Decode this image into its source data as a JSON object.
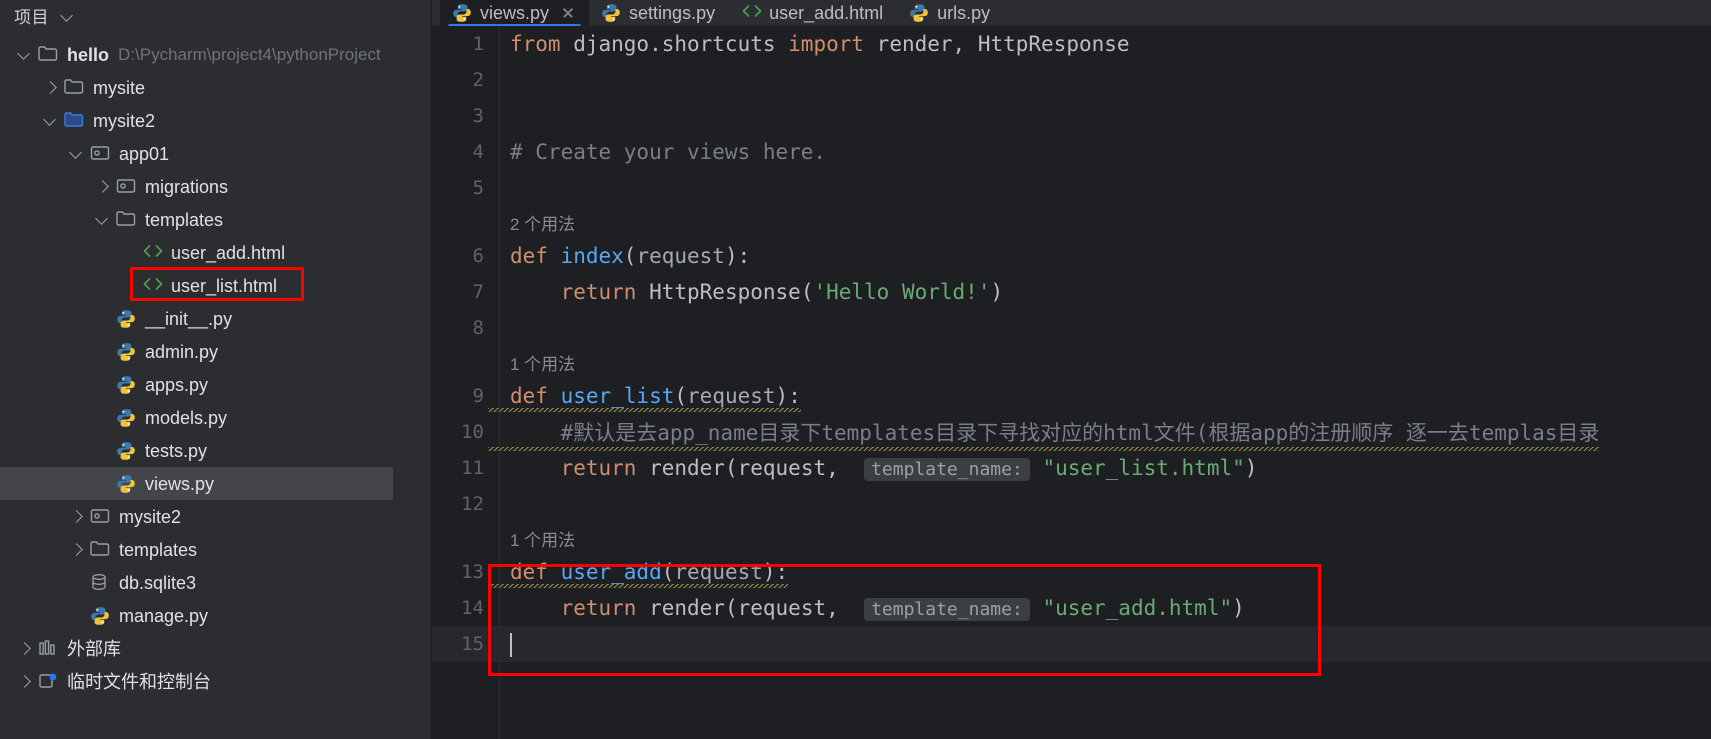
{
  "sidebar": {
    "header_title": "项目",
    "header_icon": "chevron-down-icon",
    "tree": [
      {
        "id": "hello",
        "label": "hello",
        "path": "D:\\Pycharm\\project4\\pythonProject",
        "icon": "folder-icon",
        "arrow": "down",
        "indent": 0,
        "bold": true,
        "selected": false
      },
      {
        "id": "mysite",
        "label": "mysite",
        "path": "",
        "icon": "folder-icon",
        "arrow": "right",
        "indent": 1,
        "bold": false,
        "selected": false
      },
      {
        "id": "mysite2",
        "label": "mysite2",
        "path": "",
        "icon": "folder-blue-icon",
        "arrow": "down",
        "indent": 1,
        "bold": false,
        "selected": false
      },
      {
        "id": "app01",
        "label": "app01",
        "path": "",
        "icon": "module-icon",
        "arrow": "down",
        "indent": 2,
        "bold": false,
        "selected": false
      },
      {
        "id": "migrations",
        "label": "migrations",
        "path": "",
        "icon": "module-icon",
        "arrow": "right",
        "indent": 3,
        "bold": false,
        "selected": false
      },
      {
        "id": "templates",
        "label": "templates",
        "path": "",
        "icon": "folder-icon",
        "arrow": "down",
        "indent": 3,
        "bold": false,
        "selected": false
      },
      {
        "id": "user_add",
        "label": "user_add.html",
        "path": "",
        "icon": "html-icon",
        "arrow": "none",
        "indent": 4,
        "bold": false,
        "selected": false
      },
      {
        "id": "user_list",
        "label": "user_list.html",
        "path": "",
        "icon": "html-icon",
        "arrow": "none",
        "indent": 4,
        "bold": false,
        "selected": false
      },
      {
        "id": "init",
        "label": "__init__.py",
        "path": "",
        "icon": "python-icon",
        "arrow": "none",
        "indent": 3,
        "bold": false,
        "selected": false
      },
      {
        "id": "admin",
        "label": "admin.py",
        "path": "",
        "icon": "python-icon",
        "arrow": "none",
        "indent": 3,
        "bold": false,
        "selected": false
      },
      {
        "id": "apps",
        "label": "apps.py",
        "path": "",
        "icon": "python-icon",
        "arrow": "none",
        "indent": 3,
        "bold": false,
        "selected": false
      },
      {
        "id": "models",
        "label": "models.py",
        "path": "",
        "icon": "python-icon",
        "arrow": "none",
        "indent": 3,
        "bold": false,
        "selected": false
      },
      {
        "id": "tests",
        "label": "tests.py",
        "path": "",
        "icon": "python-icon",
        "arrow": "none",
        "indent": 3,
        "bold": false,
        "selected": false
      },
      {
        "id": "views",
        "label": "views.py",
        "path": "",
        "icon": "python-icon",
        "arrow": "none",
        "indent": 3,
        "bold": false,
        "selected": true
      },
      {
        "id": "mysite2_inner",
        "label": "mysite2",
        "path": "",
        "icon": "module-icon",
        "arrow": "right",
        "indent": 2,
        "bold": false,
        "selected": false
      },
      {
        "id": "templates2",
        "label": "templates",
        "path": "",
        "icon": "folder-icon",
        "arrow": "right",
        "indent": 2,
        "bold": false,
        "selected": false
      },
      {
        "id": "dbsqlite",
        "label": "db.sqlite3",
        "path": "",
        "icon": "db-icon",
        "arrow": "none",
        "indent": 2,
        "bold": false,
        "selected": false
      },
      {
        "id": "manage",
        "label": "manage.py",
        "path": "",
        "icon": "python-icon",
        "arrow": "none",
        "indent": 2,
        "bold": false,
        "selected": false
      },
      {
        "id": "extlibs",
        "label": "外部库",
        "path": "",
        "icon": "library-icon",
        "arrow": "right",
        "indent": 0,
        "bold": false,
        "selected": false
      },
      {
        "id": "scratches",
        "label": "临时文件和控制台",
        "path": "",
        "icon": "scratches-icon",
        "arrow": "right",
        "indent": 0,
        "bold": false,
        "selected": false
      }
    ],
    "highlight_target": "user_list.html",
    "highlight_color": "#fe0000"
  },
  "editor": {
    "tabs": [
      {
        "label": "views.py",
        "icon": "python-icon",
        "active": true,
        "closable": true
      },
      {
        "label": "settings.py",
        "icon": "python-icon",
        "active": false,
        "closable": false
      },
      {
        "label": "user_add.html",
        "icon": "html-icon",
        "active": false,
        "closable": false
      },
      {
        "label": "urls.py",
        "icon": "python-icon",
        "active": false,
        "closable": false
      }
    ],
    "active_tab_accent": "#3574f0",
    "lines": [
      {
        "no": "1",
        "type": "code",
        "tokens": [
          {
            "t": "from ",
            "c": "kw"
          },
          {
            "t": "django.shortcuts ",
            "c": "plain"
          },
          {
            "t": "import ",
            "c": "kw"
          },
          {
            "t": "render, HttpResponse",
            "c": "plain"
          }
        ]
      },
      {
        "no": "2",
        "type": "code",
        "tokens": []
      },
      {
        "no": "3",
        "type": "code",
        "tokens": []
      },
      {
        "no": "4",
        "type": "code",
        "tokens": [
          {
            "t": "# Create your views here.",
            "c": "cmt"
          }
        ]
      },
      {
        "no": "5",
        "type": "code",
        "tokens": []
      },
      {
        "no": "",
        "type": "hint",
        "text": "2 个用法"
      },
      {
        "no": "6",
        "type": "code",
        "tokens": [
          {
            "t": "def ",
            "c": "kw"
          },
          {
            "t": "index",
            "c": "fn"
          },
          {
            "t": "(",
            "c": "punct"
          },
          {
            "t": "request",
            "c": "param"
          },
          {
            "t": "):",
            "c": "punct"
          }
        ]
      },
      {
        "no": "7",
        "type": "code",
        "tokens": [
          {
            "t": "    ",
            "c": "plain"
          },
          {
            "t": "return ",
            "c": "kw"
          },
          {
            "t": "HttpResponse",
            "c": "plain"
          },
          {
            "t": "(",
            "c": "punct"
          },
          {
            "t": "'Hello World!'",
            "c": "str"
          },
          {
            "t": ")",
            "c": "punct"
          }
        ]
      },
      {
        "no": "8",
        "type": "code",
        "tokens": []
      },
      {
        "no": "",
        "type": "hint",
        "text": "1 个用法"
      },
      {
        "no": "9",
        "type": "code",
        "wavy": true,
        "tokens": [
          {
            "t": "def ",
            "c": "kw"
          },
          {
            "t": "user_list",
            "c": "fn"
          },
          {
            "t": "(",
            "c": "punct"
          },
          {
            "t": "request",
            "c": "param"
          },
          {
            "t": "):",
            "c": "punct"
          }
        ]
      },
      {
        "no": "10",
        "type": "code",
        "wavy": true,
        "tokens": [
          {
            "t": "    #默认是去app_name目录下templates目录下寻找对应的html文件(根据app的注册顺序 逐一去templas目录",
            "c": "cmt"
          }
        ]
      },
      {
        "no": "11",
        "type": "code",
        "inlay": {
          "before": "    return render(request,  ",
          "label": "template_name:",
          "after": " \"user_list.html\")"
        }
      },
      {
        "no": "12",
        "type": "code",
        "tokens": []
      },
      {
        "no": "",
        "type": "hint",
        "text": "1 个用法"
      },
      {
        "no": "13",
        "type": "code",
        "wavy": true,
        "tokens": [
          {
            "t": "def ",
            "c": "kw"
          },
          {
            "t": "user_add",
            "c": "fn"
          },
          {
            "t": "(",
            "c": "punct"
          },
          {
            "t": "request",
            "c": "param"
          },
          {
            "t": "):",
            "c": "punct"
          }
        ]
      },
      {
        "no": "14",
        "type": "code",
        "inlay": {
          "before": "    return render(request,  ",
          "label": "template_name:",
          "after": " \"user_add.html\")"
        }
      },
      {
        "no": "15",
        "type": "code",
        "caret": true,
        "cursorline": true,
        "tokens": []
      }
    ],
    "highlight_color": "#fe0000",
    "highlight_note": "red box around user_add function (lines 13-14)"
  }
}
